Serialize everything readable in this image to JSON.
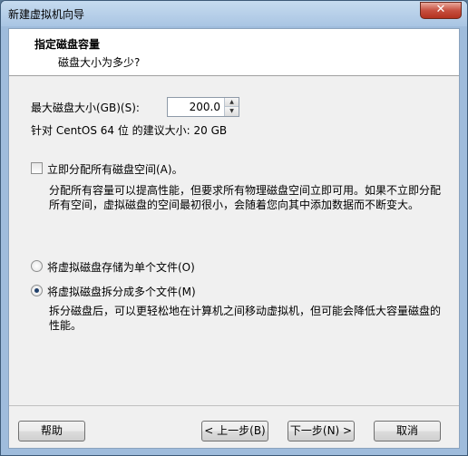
{
  "window": {
    "title": "新建虚拟机向导",
    "close_label": "✕"
  },
  "header": {
    "title": "指定磁盘容量",
    "subtitle": "磁盘大小为多少?"
  },
  "disk": {
    "size_label": "最大磁盘大小(GB)(S):",
    "size_value": "200.0",
    "recommend_text": "针对 CentOS 64 位 的建议大小: 20 GB"
  },
  "allocate": {
    "checked": false,
    "label": "立即分配所有磁盘空间(A)。",
    "description": "分配所有容量可以提高性能，但要求所有物理磁盘空间立即可用。如果不立即分配所有空间，虚拟磁盘的空间最初很小，会随着您向其中添加数据而不断变大。"
  },
  "storage_options": [
    {
      "label": "将虚拟磁盘存储为单个文件(O)",
      "checked": false
    },
    {
      "label": "将虚拟磁盘拆分成多个文件(M)",
      "checked": true
    }
  ],
  "split_description": "拆分磁盘后，可以更轻松地在计算机之间移动虚拟机，但可能会降低大容量磁盘的性能。",
  "buttons": {
    "help": "帮助",
    "prev": "< 上一步(B)",
    "next": "下一步(N) >",
    "cancel": "取消"
  }
}
